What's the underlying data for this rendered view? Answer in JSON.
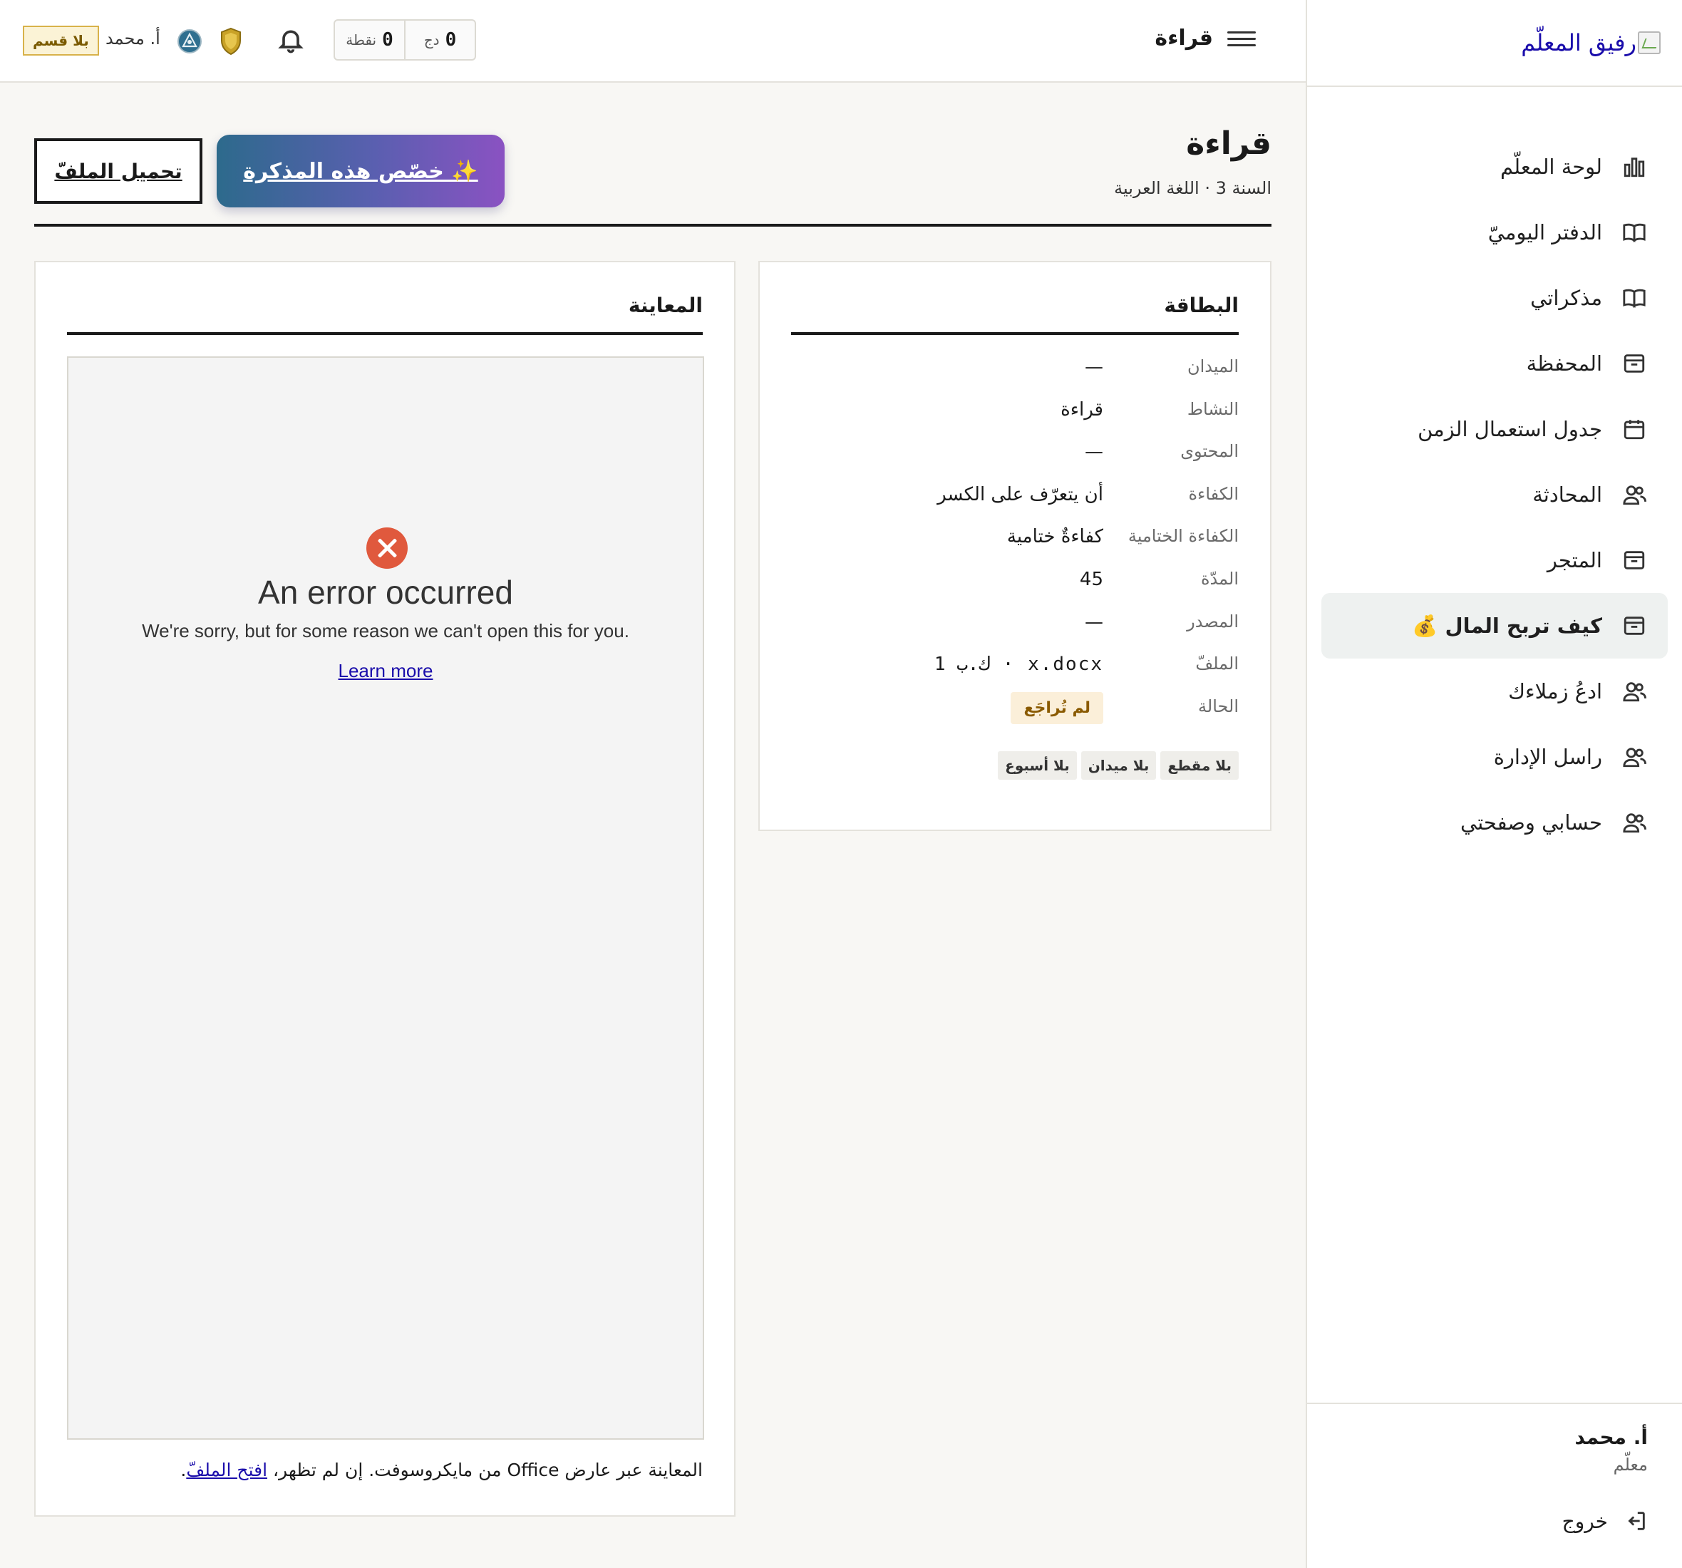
{
  "sidebar": {
    "brand": "رفيق المعلّم",
    "items": [
      {
        "label": "لوحة المعلّم",
        "icon": "bar-chart-icon"
      },
      {
        "label": "الدفتر اليوميّ",
        "icon": "book-icon"
      },
      {
        "label": "مذكراتي",
        "icon": "book-icon"
      },
      {
        "label": "المحفظة",
        "icon": "archive-icon"
      },
      {
        "label": "جدول استعمال الزمن",
        "icon": "calendar-icon"
      },
      {
        "label": "المحادثة",
        "icon": "users-icon"
      },
      {
        "label": "المتجر",
        "icon": "archive-icon"
      },
      {
        "label": "كيف تربح المال 💰",
        "icon": "archive-icon",
        "active": true
      },
      {
        "label": "ادعُ زملاءك",
        "icon": "users-icon"
      },
      {
        "label": "راسل الإدارة",
        "icon": "users-icon"
      },
      {
        "label": "حسابي وصفحتي",
        "icon": "users-icon"
      }
    ],
    "user_name": "أ. محمد",
    "user_role": "معلّم",
    "logout": "خروج"
  },
  "topbar": {
    "title": "قراءة",
    "counters": [
      {
        "value": "0",
        "unit": "دج"
      },
      {
        "value": "0",
        "unit": "نقطة"
      }
    ],
    "user": "أ. محمد",
    "section_badge": "بلا قسم"
  },
  "page": {
    "title": "قراءة",
    "subtitle": "السنة 3 · اللغة العربية",
    "customize_button": "✨ خصّص هذه المذكرة",
    "download_button": "تحميل الملفّ"
  },
  "card": {
    "title": "البطاقة",
    "rows": [
      {
        "label": "الميدان",
        "value": "—"
      },
      {
        "label": "النشاط",
        "value": "قراءة"
      },
      {
        "label": "المحتوى",
        "value": "—"
      },
      {
        "label": "الكفاءة",
        "value": "أن يتعرّف على الكسر"
      },
      {
        "label": "الكفاءة الختامية",
        "value": "كفاءةٌ ختامية"
      },
      {
        "label": "المدّة",
        "value": "45"
      },
      {
        "label": "المصدر",
        "value": "—"
      },
      {
        "label": "الملفّ",
        "value": "x.docx · ك.ب 1"
      },
      {
        "label": "الحالة",
        "value": "لم تُراجَع"
      }
    ],
    "tags": [
      "بلا مقطع",
      "بلا ميدان",
      "بلا أسبوع"
    ]
  },
  "preview": {
    "title": "المعاينة",
    "error_title": "An error occurred",
    "error_message": "We're sorry, but for some reason we can't open this for you.",
    "error_link": "Learn more",
    "note_text": "المعاينة عبر عارض Office من مايكروسوفت. إن لم تظهر، ",
    "note_link": "افتح الملفّ",
    "note_end": "."
  }
}
